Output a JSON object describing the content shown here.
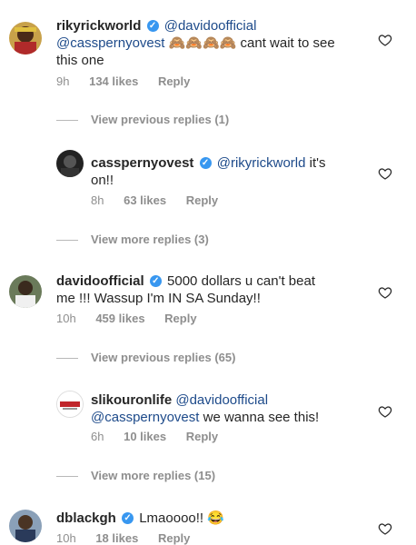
{
  "comments": [
    {
      "user": "rikyrickworld",
      "verified": true,
      "text_mention1": "@davidoofficial",
      "text_mention2": "@casspernyovest",
      "text_emojis": "🙈🙈🙈🙈",
      "text_after": " cant wait to see",
      "text_line2": "this one",
      "time": "9h",
      "likes": "134 likes",
      "reply": "Reply"
    },
    {
      "user": "casspernyovest",
      "verified": true,
      "text_mention": "@rikyrickworld",
      "text_after": " it's",
      "text_line2": "on!!",
      "time": "8h",
      "likes": "63 likes",
      "reply": "Reply"
    },
    {
      "user": "davidoofficial",
      "verified": true,
      "text_line1": " 5000 dollars u can't beat",
      "text_line2": "me !!! Wassup I'm IN SA Sunday!!",
      "time": "10h",
      "likes": "459 likes",
      "reply": "Reply"
    },
    {
      "user": "slikouronlife",
      "verified": false,
      "text_mention1": "@davidoofficial",
      "text_mention2": "@casspernyovest",
      "text_after": " we wanna see this!",
      "time": "6h",
      "likes": "10 likes",
      "reply": "Reply"
    },
    {
      "user": "dblackgh",
      "verified": true,
      "text": " Lmaoooo!! ",
      "emoji": "😂",
      "time": "10h",
      "likes": "18 likes",
      "reply": "Reply"
    }
  ],
  "view_rows": [
    "View previous replies (1)",
    "View more replies (3)",
    "View previous replies (65)",
    "View more replies (15)"
  ],
  "icons": {
    "verified": "check-badge-icon",
    "like": "heart-outline-icon"
  },
  "colors": {
    "mention": "#1d4a8a",
    "verified": "#3897f0",
    "meta": "#8e8e8e"
  }
}
